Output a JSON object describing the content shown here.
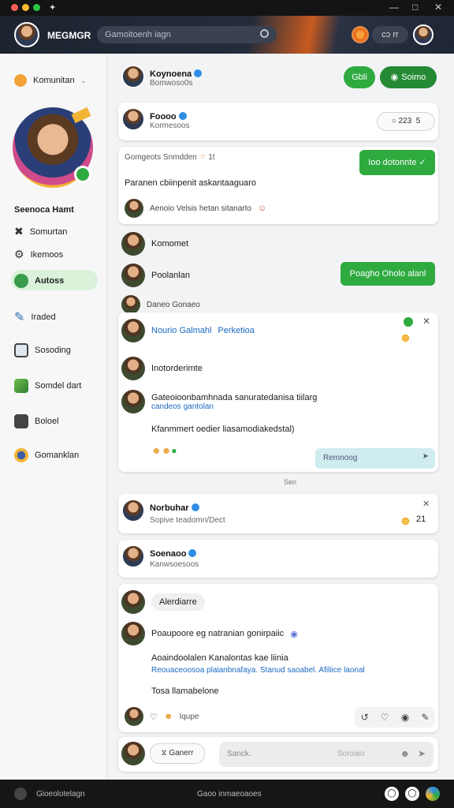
{
  "window": {
    "title_glyph": "✦"
  },
  "topbar": {
    "app_title": "MEGMGR",
    "search_placeholder": "Gamoitoenh iagn",
    "status_text": "cɔ rr",
    "colors": {
      "accent_orange": "#e8731f",
      "green": "#2eaa3f"
    }
  },
  "sidebar": {
    "workspace": "Komunitan",
    "profile_name": "Seenoca Hamt",
    "items": [
      {
        "label": "Somurtan",
        "icon": "close-x-icon"
      },
      {
        "label": "Ikemoos",
        "icon": "gear-icon"
      },
      {
        "label": "Autoss",
        "icon": "globe-icon",
        "active": true
      },
      {
        "label": "Iraded",
        "icon": "pencil-icon"
      },
      {
        "label": "Sosoding",
        "icon": "window-icon"
      },
      {
        "label": "Somdel dart",
        "icon": "image-icon"
      },
      {
        "label": "Boloel",
        "icon": "flag-icon"
      },
      {
        "label": "Gomanklan",
        "icon": "star-badge-icon"
      }
    ]
  },
  "header_card": {
    "name": "Koynoena",
    "sub": "Bomwoso0s",
    "btn1": "Gbli",
    "btn2": "Soimo"
  },
  "card2": {
    "name": "Foooo",
    "sub": "Kormesoos",
    "count": "223",
    "count2": "5"
  },
  "card3": {
    "meta": "Gomgeots Snmdden",
    "meta_count": "1t",
    "action": "Ioo dotonnte",
    "body": "Paranen cbiinpenit askantaaguaro",
    "reply": "Aenoio Velsis hetan sitanarto"
  },
  "loose1": {
    "name": "Komomet"
  },
  "loose2": {
    "name": "Poolanlan",
    "bubble": "Poagho Oholo alanl"
  },
  "loose3": {
    "name": "Daneo Gonaeo"
  },
  "thread": {
    "title": "Nourio Galmahl",
    "title_link": "Perketioa",
    "author": "Inotorderimte",
    "line1": "Gateoioonbamhnada sanuratedanisa tiilarg",
    "line1_link": "candeos gantolan",
    "line2": "Kfanmmert oedier liasamodiakedstal)",
    "reply_placeholder": "Remnoog"
  },
  "separator": "Sen",
  "card4": {
    "name": "Norbuhar",
    "sub": "Sopive teadomn/Dect",
    "count": "21"
  },
  "card5": {
    "name": "Soenaoo",
    "sub": "Kanwsoesoos"
  },
  "card6": {
    "chip": "Alerdiarre",
    "head": "Poaupoore eg natranian gonirpaiic",
    "line1": "Aoaindoolalen Kanalontas kae liinia",
    "link": "Reouaceoosoa plaianbnafaya. Stanud saoabel. Afiliice laonal",
    "line2": "Tosa llamabelone",
    "reaction": "Iqupe"
  },
  "composer": {
    "attach_label": "Ganerr",
    "placeholder": "Sanck.",
    "hint": "Soroaio"
  },
  "bottombar": {
    "left": "Gioeolotelagn",
    "center": "Gaoo inmaeoaoes"
  }
}
